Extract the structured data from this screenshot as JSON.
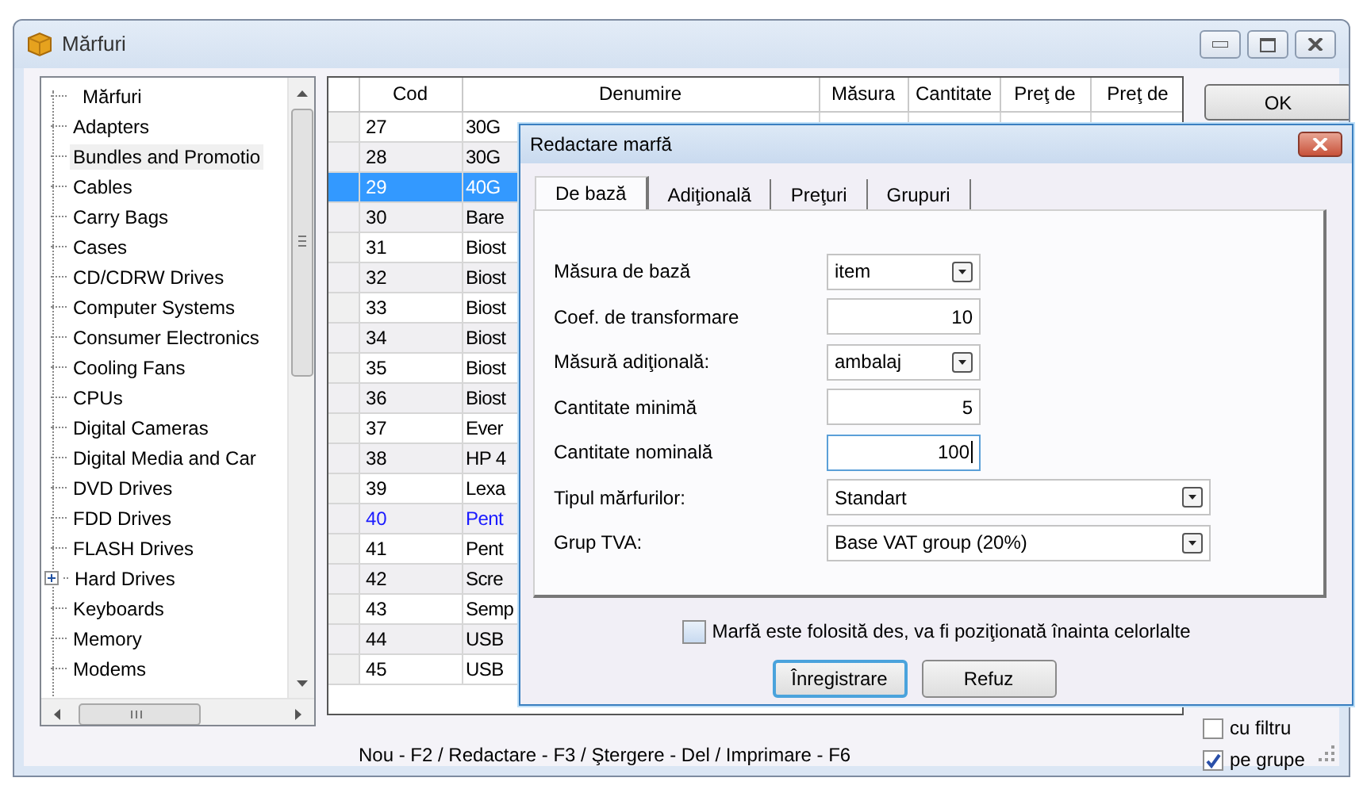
{
  "window": {
    "title": "Mărfuri"
  },
  "tree": {
    "root": "Mărfuri",
    "items": [
      {
        "label": "Adapters",
        "expandable": false,
        "selected": false
      },
      {
        "label": "Bundles and Promotio",
        "expandable": false,
        "selected": true
      },
      {
        "label": "Cables",
        "expandable": false,
        "selected": false
      },
      {
        "label": "Carry Bags",
        "expandable": false,
        "selected": false
      },
      {
        "label": "Cases",
        "expandable": false,
        "selected": false
      },
      {
        "label": "CD/CDRW Drives",
        "expandable": false,
        "selected": false
      },
      {
        "label": "Computer Systems",
        "expandable": false,
        "selected": false
      },
      {
        "label": "Consumer Electronics",
        "expandable": false,
        "selected": false
      },
      {
        "label": "Cooling Fans",
        "expandable": false,
        "selected": false
      },
      {
        "label": "CPUs",
        "expandable": false,
        "selected": false
      },
      {
        "label": "Digital Cameras",
        "expandable": false,
        "selected": false
      },
      {
        "label": "Digital Media and Car",
        "expandable": false,
        "selected": false
      },
      {
        "label": "DVD Drives",
        "expandable": false,
        "selected": false
      },
      {
        "label": "FDD Drives",
        "expandable": false,
        "selected": false
      },
      {
        "label": "FLASH Drives",
        "expandable": false,
        "selected": false
      },
      {
        "label": "Hard Drives",
        "expandable": true,
        "selected": false
      },
      {
        "label": "Keyboards",
        "expandable": false,
        "selected": false
      },
      {
        "label": "Memory",
        "expandable": false,
        "selected": false
      },
      {
        "label": "Modems",
        "expandable": false,
        "selected": false
      }
    ]
  },
  "table": {
    "columns": [
      "Cod",
      "Denumire",
      "Măsura",
      "Cantitate",
      "Preţ de",
      "Preţ de"
    ],
    "rows": [
      {
        "cod": "27",
        "name": "30G",
        "selected": false,
        "highlighted": false
      },
      {
        "cod": "28",
        "name": "30G",
        "selected": false,
        "highlighted": false
      },
      {
        "cod": "29",
        "name": "40G",
        "selected": true,
        "highlighted": false
      },
      {
        "cod": "30",
        "name": "Bare",
        "selected": false,
        "highlighted": false
      },
      {
        "cod": "31",
        "name": "Biost",
        "selected": false,
        "highlighted": false
      },
      {
        "cod": "32",
        "name": "Biost",
        "selected": false,
        "highlighted": false
      },
      {
        "cod": "33",
        "name": "Biost",
        "selected": false,
        "highlighted": false
      },
      {
        "cod": "34",
        "name": "Biost",
        "selected": false,
        "highlighted": false
      },
      {
        "cod": "35",
        "name": "Biost",
        "selected": false,
        "highlighted": false
      },
      {
        "cod": "36",
        "name": "Biost",
        "selected": false,
        "highlighted": false
      },
      {
        "cod": "37",
        "name": "Ever",
        "selected": false,
        "highlighted": false
      },
      {
        "cod": "38",
        "name": "HP 4",
        "selected": false,
        "highlighted": false
      },
      {
        "cod": "39",
        "name": "Lexa",
        "selected": false,
        "highlighted": false
      },
      {
        "cod": "40",
        "name": "Pent",
        "selected": false,
        "highlighted": true
      },
      {
        "cod": "41",
        "name": "Pent",
        "selected": false,
        "highlighted": false
      },
      {
        "cod": "42",
        "name": "Scre",
        "selected": false,
        "highlighted": false
      },
      {
        "cod": "43",
        "name": "Semp",
        "selected": false,
        "highlighted": false
      },
      {
        "cod": "44",
        "name": "USB",
        "selected": false,
        "highlighted": false
      },
      {
        "cod": "45",
        "name": "USB",
        "selected": false,
        "highlighted": false
      }
    ]
  },
  "status_bar": "Nou - F2 / Redactare - F3 / Ştergere - Del / Imprimare - F6",
  "ok_button": "OK",
  "options": [
    {
      "label": "cu filtru",
      "checked": false
    },
    {
      "label": "pe grupe",
      "checked": true
    }
  ],
  "dialog": {
    "title": "Redactare marfă",
    "tabs": [
      {
        "label": "De bază",
        "selected": true
      },
      {
        "label": "Adiţională",
        "selected": false
      },
      {
        "label": "Preţuri",
        "selected": false
      },
      {
        "label": "Grupuri",
        "selected": false
      }
    ],
    "fields": [
      {
        "label": "Măsura de bază",
        "kind": "select",
        "value": "item",
        "focused": false
      },
      {
        "label": "Coef. de transformare",
        "kind": "number",
        "value": "10",
        "focused": false
      },
      {
        "label": "Măsură adiţională:",
        "kind": "select",
        "value": "ambalaj",
        "focused": false
      },
      {
        "label": "Cantitate minimă",
        "kind": "number",
        "value": "5",
        "focused": false
      },
      {
        "label": "Cantitate nominală",
        "kind": "number",
        "value": "100",
        "focused": true
      },
      {
        "label": "Tipul mărfurilor:",
        "kind": "wide-select",
        "value": "Standart",
        "focused": false
      },
      {
        "label": "Grup TVA:",
        "kind": "wide-select",
        "value": "Base VAT group (20%)",
        "focused": false
      }
    ],
    "frequent": {
      "label": "Marfă  este folosită des, va fi poziţionată înainta celorlalte",
      "checked": false
    },
    "buttons": [
      {
        "label": "Înregistrare",
        "default": true
      },
      {
        "label": "Refuz",
        "default": false
      }
    ]
  }
}
